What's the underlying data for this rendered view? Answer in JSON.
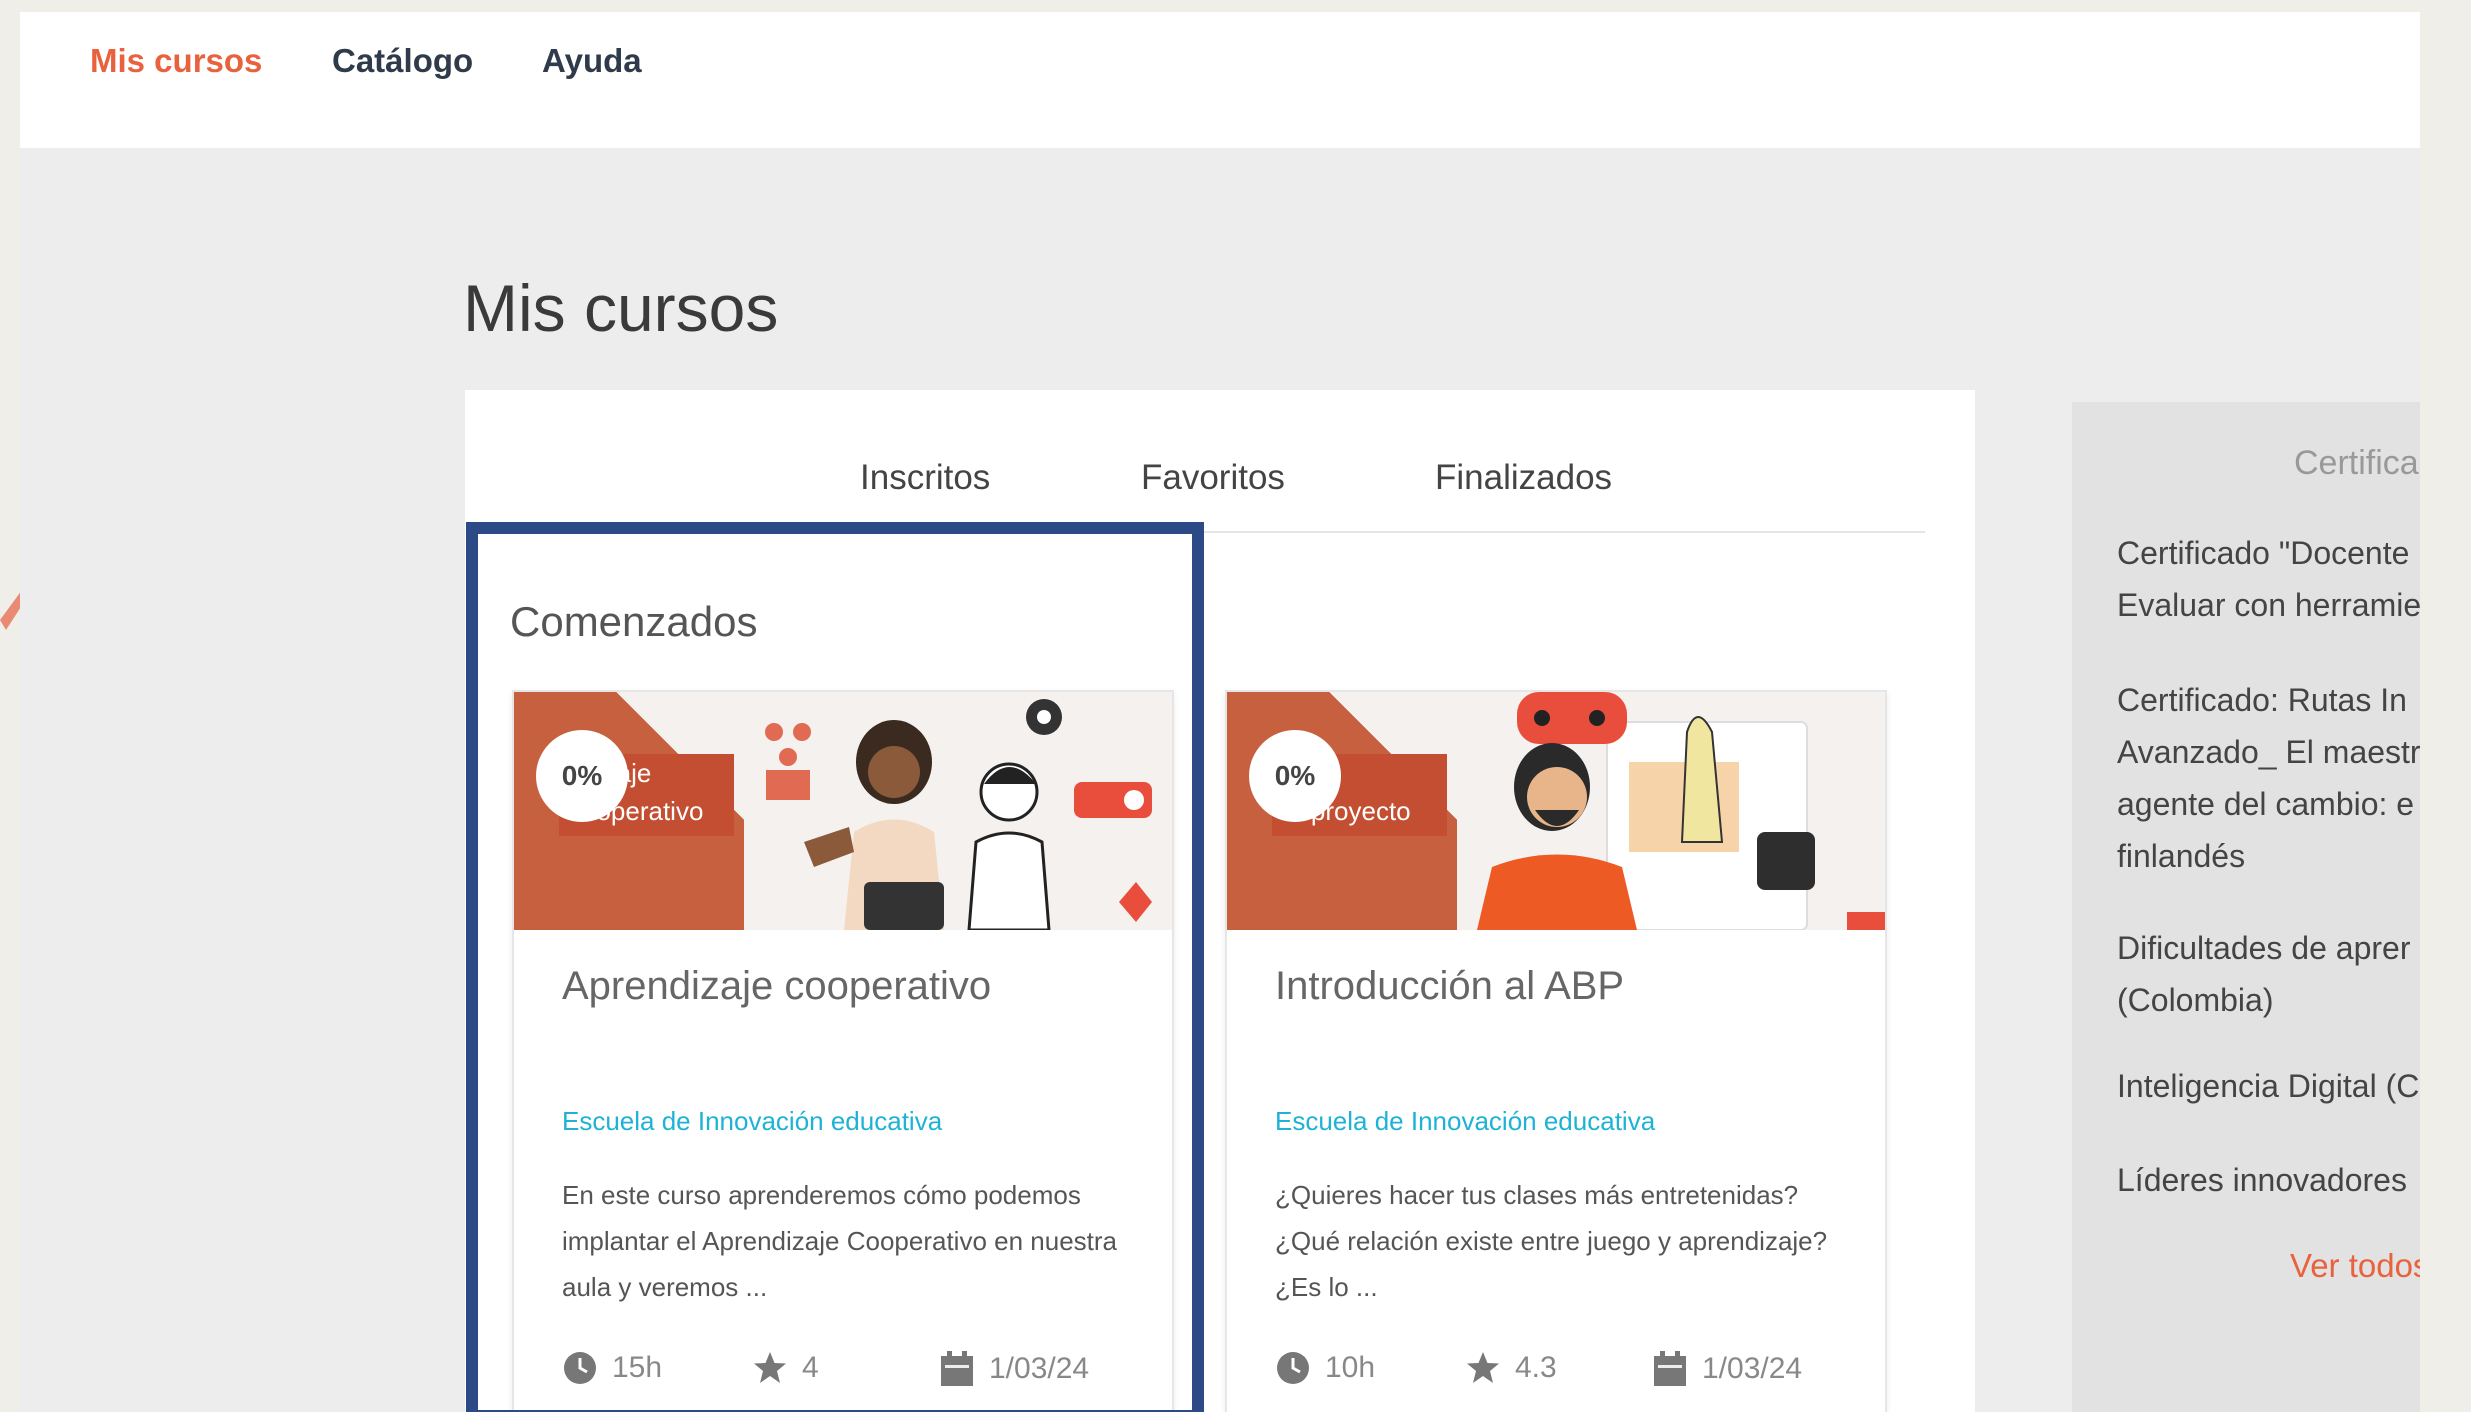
{
  "nav": {
    "items": [
      {
        "label": "Mis cursos",
        "active": true
      },
      {
        "label": "Catálogo",
        "active": false
      },
      {
        "label": "Ayuda",
        "active": false
      }
    ]
  },
  "page": {
    "title": "Mis cursos"
  },
  "tabs": [
    {
      "label": "Inscritos",
      "active": true
    },
    {
      "label": "Favoritos",
      "active": false
    },
    {
      "label": "Finalizados",
      "active": false
    }
  ],
  "section": {
    "heading": "Comenzados"
  },
  "courses": [
    {
      "progress": "0%",
      "thumb_tag": "ndizaje\ncooperativo",
      "title": "Aprendizaje cooperativo",
      "school": "Escuela de Innovación educativa",
      "description": "En este curso aprenderemos cómo podemos implantar el Aprendizaje Cooperativo en nuestra aula y veremos ...",
      "duration": "15h",
      "rating": "4",
      "date": "1/03/24"
    },
    {
      "progress": "0%",
      "thumb_tag": "fica\ntu proyecto",
      "title": "Introducción al ABP",
      "school": "Escuela de Innovación educativa",
      "description": "¿Quieres hacer tus clases más entretenidas? ¿Qué relación existe entre juego y aprendizaje? ¿Es lo ...",
      "duration": "10h",
      "rating": "4.3",
      "date": "1/03/24"
    }
  ],
  "certificates": {
    "heading": "Certificac",
    "items": [
      "Certificado \"Docente Evaluar con herramie",
      "Certificado: Rutas In Avanzado_ El maestr agente del cambio: e finlandés",
      "Dificultades de aprer (Colombia)",
      "Inteligencia Digital (C",
      "Líderes innovadores"
    ],
    "see_all": "Ver todos"
  },
  "colors": {
    "accent": "#e8623d",
    "highlight_border": "#2b4a86",
    "link_blue": "#1eb3d6"
  }
}
